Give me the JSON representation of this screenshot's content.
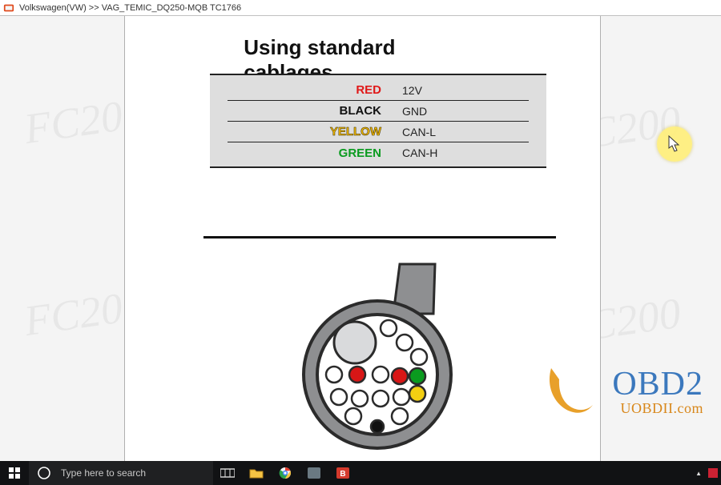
{
  "window": {
    "title": "Volkswagen(VW) >> VAG_TEMIC_DQ250-MQB TC1766"
  },
  "doc": {
    "heading": "Using  standard cablages",
    "rows": [
      {
        "color_label": "RED",
        "signal": "12V",
        "css": "c-red"
      },
      {
        "color_label": "BLACK",
        "signal": "GND",
        "css": "c-black"
      },
      {
        "color_label": "YELLOW",
        "signal": "CAN-L",
        "css": "c-yellow"
      },
      {
        "color_label": "GREEN",
        "signal": "CAN-H",
        "css": "c-green"
      }
    ]
  },
  "watermark": {
    "text": "FC200"
  },
  "brand": {
    "top": "OBD2",
    "bottom": "UOBDII.com"
  },
  "taskbar": {
    "search_placeholder": "Type here to search"
  }
}
